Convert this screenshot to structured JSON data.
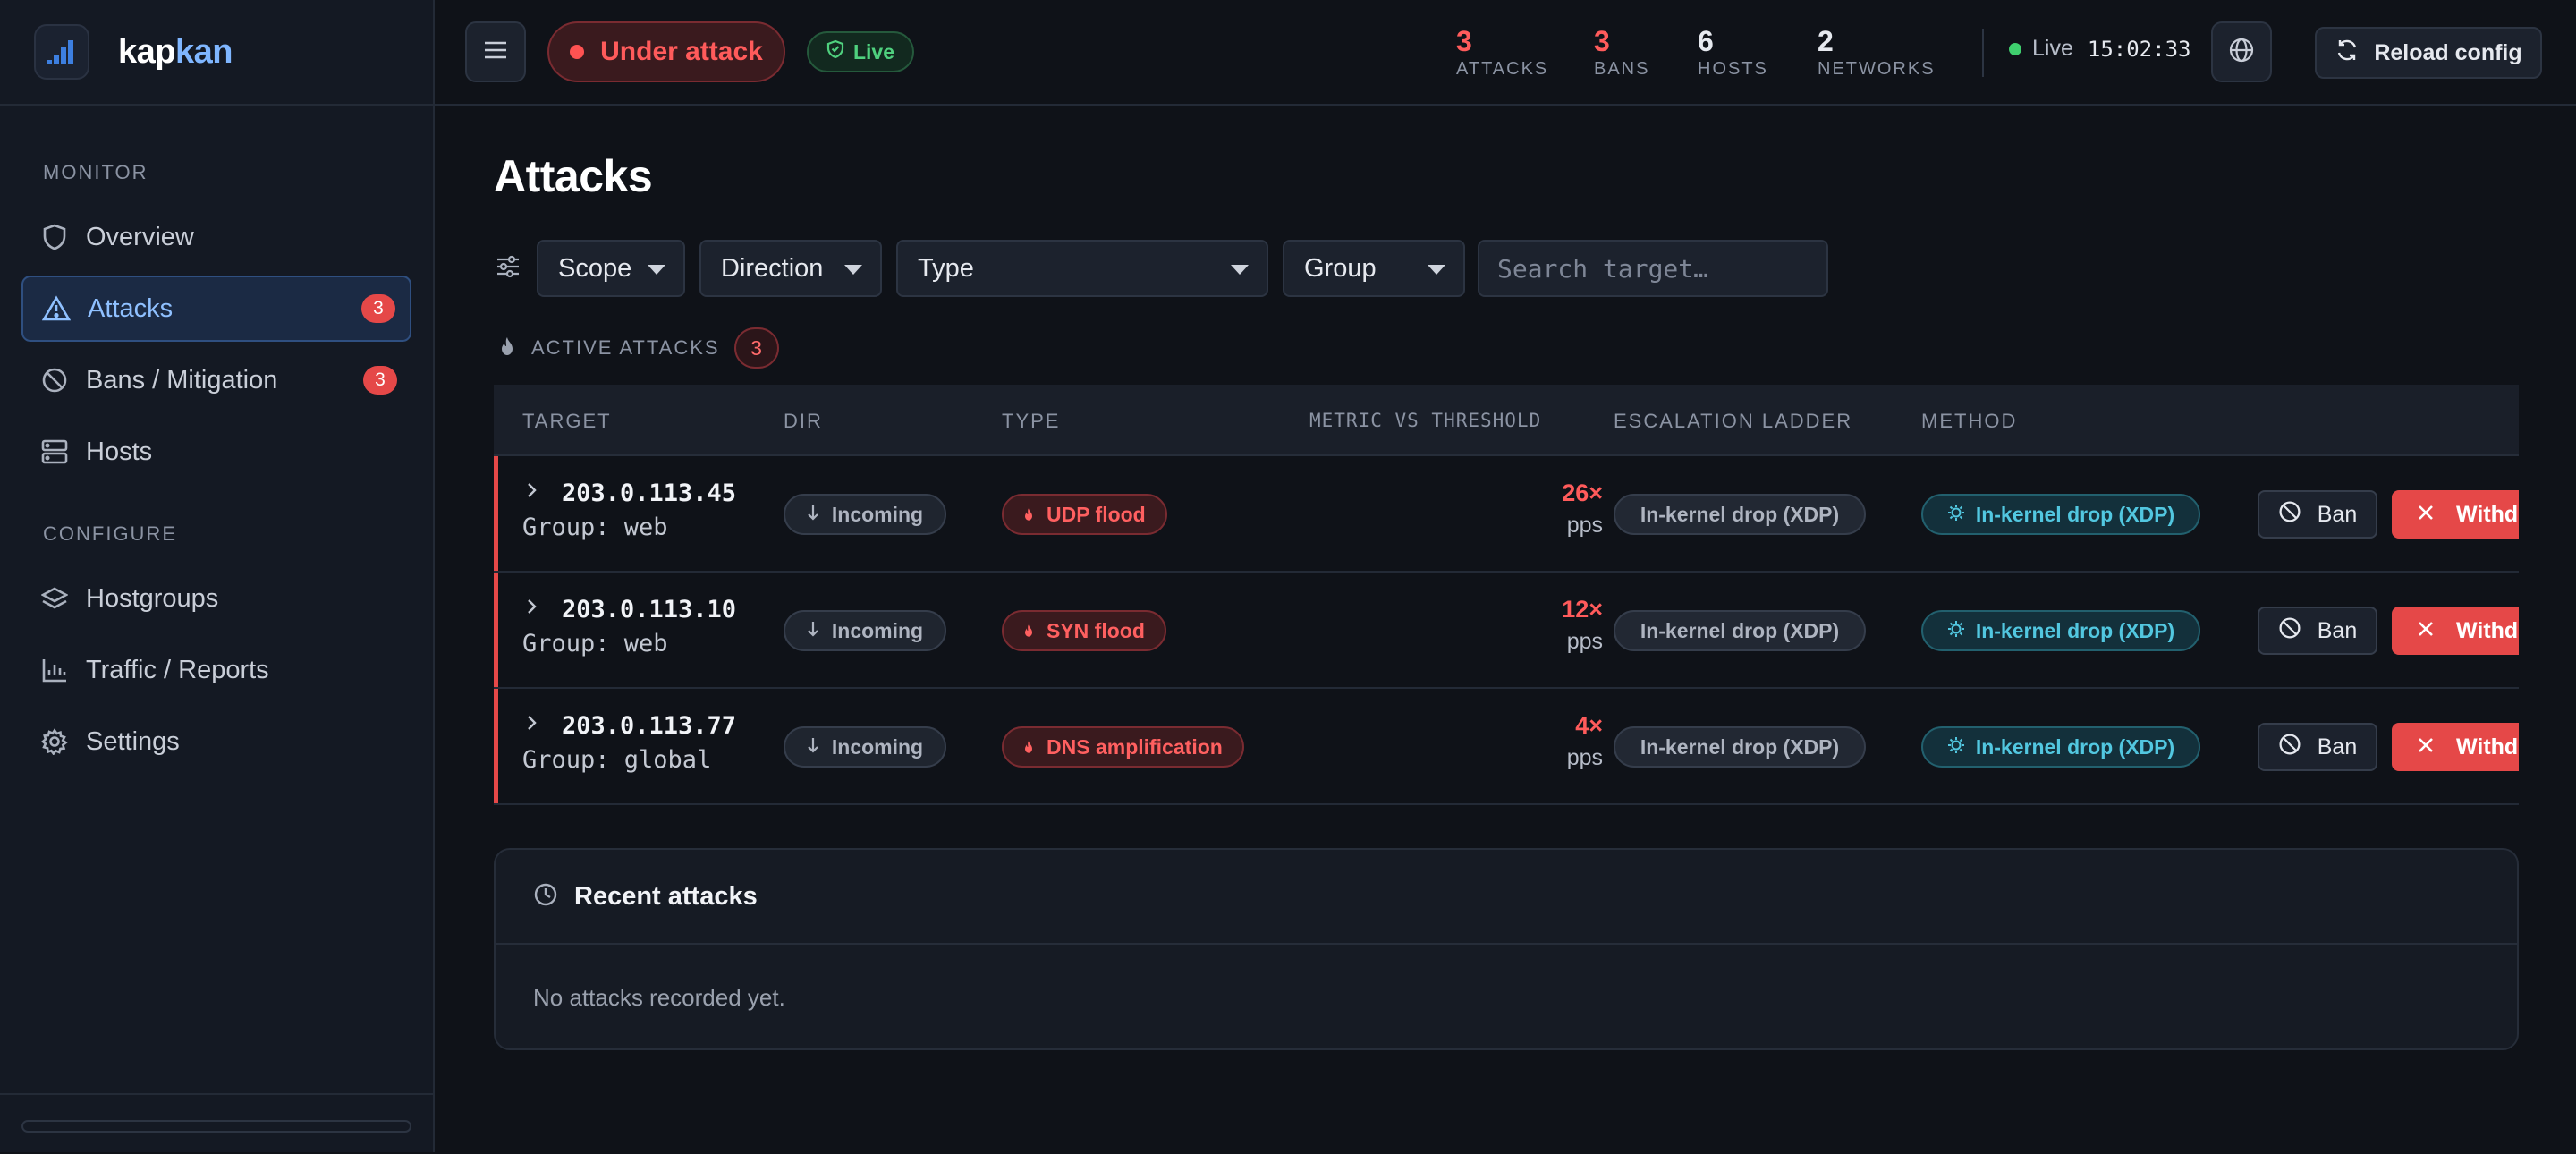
{
  "brand": {
    "name_a": "kap",
    "name_b": "kan"
  },
  "sidebar": {
    "sections": [
      "MONITOR",
      "CONFIGURE"
    ],
    "items": [
      {
        "label": "Overview",
        "icon": "shield-icon"
      },
      {
        "label": "Attacks",
        "icon": "warning-triangle-icon",
        "badge": "3",
        "active": true
      },
      {
        "label": "Bans / Mitigation",
        "icon": "ban-icon",
        "badge": "3"
      },
      {
        "label": "Hosts",
        "icon": "server-icon"
      },
      {
        "label": "Hostgroups",
        "icon": "layers-icon"
      },
      {
        "label": "Traffic / Reports",
        "icon": "bar-chart-icon"
      },
      {
        "label": "Settings",
        "icon": "gear-icon"
      }
    ]
  },
  "topbar": {
    "status": "Under attack",
    "live_badge": "Live",
    "stats": [
      {
        "value": "3",
        "label": "ATTACKS"
      },
      {
        "value": "3",
        "label": "BANS"
      },
      {
        "value": "6",
        "label": "HOSTS"
      },
      {
        "value": "2",
        "label": "NETWORKS"
      }
    ],
    "live_label": "Live",
    "clock": "15:02:33",
    "reload_label": "Reload config"
  },
  "main": {
    "title": "Attacks",
    "filters": {
      "scope": "Scope",
      "direction": "Direction",
      "type": "Type",
      "group": "Group",
      "search_placeholder": "Search target…"
    },
    "active_label": "ACTIVE ATTACKS",
    "active_count": "3",
    "columns": [
      "TARGET",
      "DIR",
      "TYPE",
      "METRIC VS THRESHOLD",
      "ESCALATION LADDER",
      "METHOD"
    ],
    "rows": [
      {
        "target": "203.0.113.45",
        "group": "Group: web",
        "dir": "Incoming",
        "type": "UDP flood",
        "metric": "26×",
        "unit": "pps",
        "ladder": "In-kernel drop (XDP)",
        "method": "In-kernel drop (XDP)",
        "ban": "Ban",
        "withdraw": "Withdraw"
      },
      {
        "target": "203.0.113.10",
        "group": "Group: web",
        "dir": "Incoming",
        "type": "SYN flood",
        "metric": "12×",
        "unit": "pps",
        "ladder": "In-kernel drop (XDP)",
        "method": "In-kernel drop (XDP)",
        "ban": "Ban",
        "withdraw": "Withdraw"
      },
      {
        "target": "203.0.113.77",
        "group": "Group: global",
        "dir": "Incoming",
        "type": "DNS amplification",
        "metric": "4×",
        "unit": "pps",
        "ladder": "In-kernel drop (XDP)",
        "method": "In-kernel drop (XDP)",
        "ban": "Ban",
        "withdraw": "Withdraw"
      }
    ],
    "recent": {
      "title": "Recent attacks",
      "empty": "No attacks recorded yet."
    }
  },
  "colors": {
    "accent": "#7fb6ff",
    "danger": "#e54848",
    "success": "#3fcf6e",
    "info": "#52c7e0"
  }
}
